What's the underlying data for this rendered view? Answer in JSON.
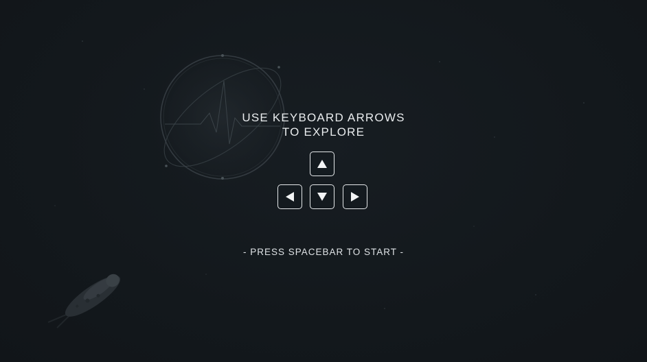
{
  "instructions": {
    "line1": "USE KEYBOARD ARROWS",
    "line2": "TO EXPLORE"
  },
  "controls": {
    "up": "arrow-up",
    "left": "arrow-left",
    "down": "arrow-down",
    "right": "arrow-right"
  },
  "start_prompt": "- PRESS SPACEBAR TO START -",
  "colors": {
    "background": "#141a1f",
    "text": "#e9ecee",
    "key_border": "#e6e9eb"
  }
}
